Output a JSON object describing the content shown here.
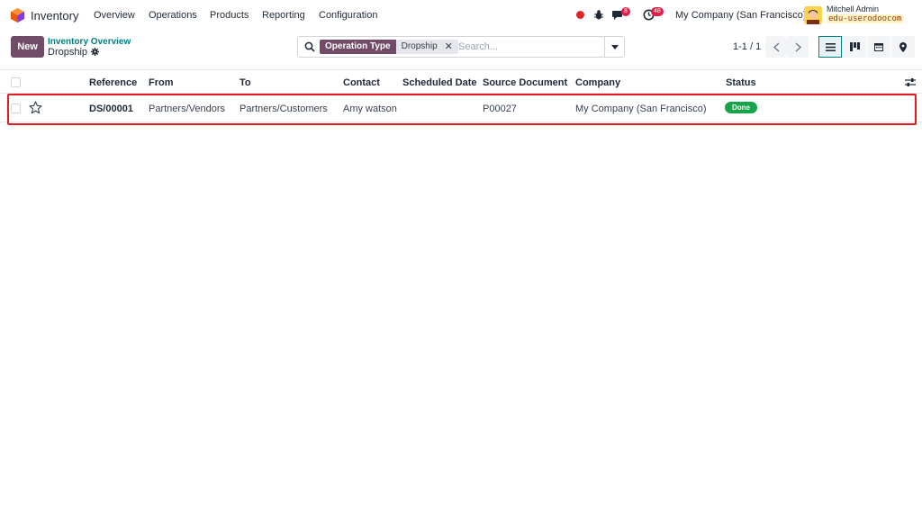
{
  "navbar": {
    "app_name": "Inventory",
    "menus": [
      "Overview",
      "Operations",
      "Products",
      "Reporting",
      "Configuration"
    ],
    "chat_badge": "8",
    "activity_badge": "48",
    "company": "My Company (San Francisco)",
    "user_name": "Mitchell Admin",
    "database": "edu-userodoocom"
  },
  "control_panel": {
    "new_label": "New",
    "breadcrumb_parent": "Inventory Overview",
    "breadcrumb_current": "Dropship",
    "search": {
      "facet_label": "Operation Type",
      "facet_value": "Dropship",
      "placeholder": "Search..."
    },
    "pager": "1-1 / 1"
  },
  "table": {
    "columns": [
      "Reference",
      "From",
      "To",
      "Contact",
      "Scheduled Date",
      "Source Document",
      "Company",
      "Status"
    ],
    "rows": [
      {
        "reference": "DS/00001",
        "from": "Partners/Vendors",
        "to": "Partners/Customers",
        "contact": "Amy watson",
        "scheduled_date": "",
        "source_document": "P00027",
        "company": "My Company (San Francisco)",
        "status": "Done"
      }
    ]
  },
  "colors": {
    "brand": "#714b67",
    "accent": "#017e84",
    "done": "#16a34a",
    "highlight": "#e11d24"
  }
}
